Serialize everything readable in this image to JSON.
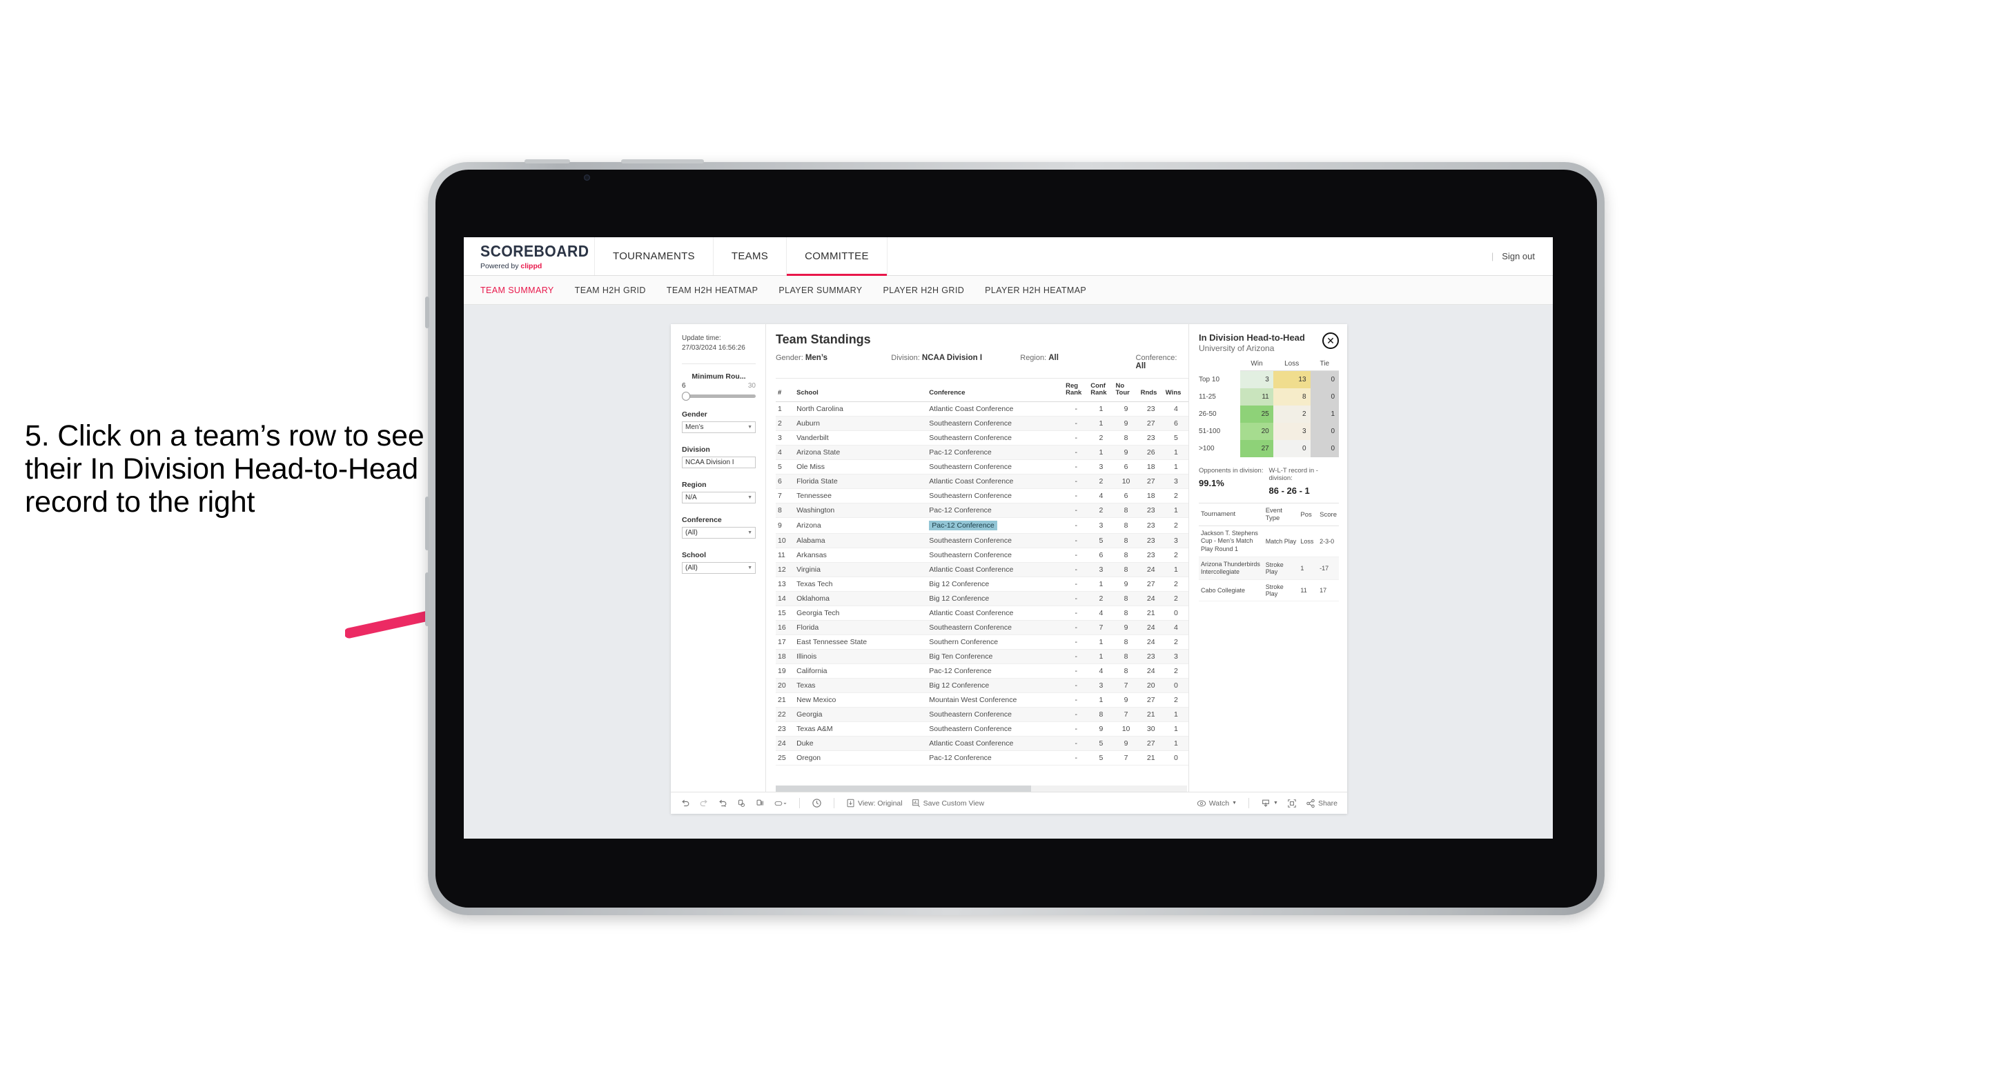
{
  "caption": {
    "text": "5. Click on a team’s row to see their In Division Head-to-Head record to the right"
  },
  "app": {
    "brand_name": "SCOREBOARD",
    "brand_powered_prefix": "Powered by ",
    "brand_powered_name": "clippd",
    "nav_items": [
      {
        "label": "TOURNAMENTS",
        "active": false
      },
      {
        "label": "TEAMS",
        "active": false
      },
      {
        "label": "COMMITTEE",
        "active": true
      }
    ],
    "nav_separator": "|",
    "sign_out_label": "Sign out",
    "subnav_items": [
      {
        "label": "TEAM SUMMARY",
        "active": true
      },
      {
        "label": "TEAM H2H GRID",
        "active": false
      },
      {
        "label": "TEAM H2H HEATMAP",
        "active": false
      },
      {
        "label": "PLAYER SUMMARY",
        "active": false
      },
      {
        "label": "PLAYER H2H GRID",
        "active": false
      },
      {
        "label": "PLAYER H2H HEATMAP",
        "active": false
      }
    ]
  },
  "filters": {
    "update_time_label": "Update time:",
    "update_time_value": "27/03/2024 16:56:26",
    "slider": {
      "title": "Minimum Rou...",
      "min": "6",
      "max": "30"
    },
    "groups": [
      {
        "label": "Gender",
        "value": "Men’s"
      },
      {
        "label": "Division",
        "value": "NCAA Division I"
      },
      {
        "label": "Region",
        "value": "N/A"
      },
      {
        "label": "Conference",
        "value": "(All)"
      },
      {
        "label": "School",
        "value": "(All)"
      }
    ]
  },
  "standings": {
    "title": "Team Standings",
    "context": [
      {
        "label": "Gender:",
        "value": "Men’s"
      },
      {
        "label": "Division:",
        "value": "NCAA Division I"
      },
      {
        "label": "Region:",
        "value": "All"
      },
      {
        "label": "Conference:",
        "value": "All"
      }
    ],
    "columns": [
      "#",
      "School",
      "Conference",
      "Reg Rank",
      "Conf Rank",
      "No Tour",
      "Rnds",
      "Wins"
    ],
    "highlighted_row_index": 8,
    "rows": [
      {
        "rank": "1",
        "school": "North Carolina",
        "conference": "Atlantic Coast Conference",
        "reg_rank": "-",
        "conf_rank": "1",
        "no_tour": "9",
        "rnds": "23",
        "wins": "4"
      },
      {
        "rank": "2",
        "school": "Auburn",
        "conference": "Southeastern Conference",
        "reg_rank": "-",
        "conf_rank": "1",
        "no_tour": "9",
        "rnds": "27",
        "wins": "6"
      },
      {
        "rank": "3",
        "school": "Vanderbilt",
        "conference": "Southeastern Conference",
        "reg_rank": "-",
        "conf_rank": "2",
        "no_tour": "8",
        "rnds": "23",
        "wins": "5"
      },
      {
        "rank": "4",
        "school": "Arizona State",
        "conference": "Pac-12 Conference",
        "reg_rank": "-",
        "conf_rank": "1",
        "no_tour": "9",
        "rnds": "26",
        "wins": "1"
      },
      {
        "rank": "5",
        "school": "Ole Miss",
        "conference": "Southeastern Conference",
        "reg_rank": "-",
        "conf_rank": "3",
        "no_tour": "6",
        "rnds": "18",
        "wins": "1"
      },
      {
        "rank": "6",
        "school": "Florida State",
        "conference": "Atlantic Coast Conference",
        "reg_rank": "-",
        "conf_rank": "2",
        "no_tour": "10",
        "rnds": "27",
        "wins": "3"
      },
      {
        "rank": "7",
        "school": "Tennessee",
        "conference": "Southeastern Conference",
        "reg_rank": "-",
        "conf_rank": "4",
        "no_tour": "6",
        "rnds": "18",
        "wins": "2"
      },
      {
        "rank": "8",
        "school": "Washington",
        "conference": "Pac-12 Conference",
        "reg_rank": "-",
        "conf_rank": "2",
        "no_tour": "8",
        "rnds": "23",
        "wins": "1"
      },
      {
        "rank": "9",
        "school": "Arizona",
        "conference": "Pac-12 Conference",
        "reg_rank": "-",
        "conf_rank": "3",
        "no_tour": "8",
        "rnds": "23",
        "wins": "2"
      },
      {
        "rank": "10",
        "school": "Alabama",
        "conference": "Southeastern Conference",
        "reg_rank": "-",
        "conf_rank": "5",
        "no_tour": "8",
        "rnds": "23",
        "wins": "3"
      },
      {
        "rank": "11",
        "school": "Arkansas",
        "conference": "Southeastern Conference",
        "reg_rank": "-",
        "conf_rank": "6",
        "no_tour": "8",
        "rnds": "23",
        "wins": "2"
      },
      {
        "rank": "12",
        "school": "Virginia",
        "conference": "Atlantic Coast Conference",
        "reg_rank": "-",
        "conf_rank": "3",
        "no_tour": "8",
        "rnds": "24",
        "wins": "1"
      },
      {
        "rank": "13",
        "school": "Texas Tech",
        "conference": "Big 12 Conference",
        "reg_rank": "-",
        "conf_rank": "1",
        "no_tour": "9",
        "rnds": "27",
        "wins": "2"
      },
      {
        "rank": "14",
        "school": "Oklahoma",
        "conference": "Big 12 Conference",
        "reg_rank": "-",
        "conf_rank": "2",
        "no_tour": "8",
        "rnds": "24",
        "wins": "2"
      },
      {
        "rank": "15",
        "school": "Georgia Tech",
        "conference": "Atlantic Coast Conference",
        "reg_rank": "-",
        "conf_rank": "4",
        "no_tour": "8",
        "rnds": "21",
        "wins": "0"
      },
      {
        "rank": "16",
        "school": "Florida",
        "conference": "Southeastern Conference",
        "reg_rank": "-",
        "conf_rank": "7",
        "no_tour": "9",
        "rnds": "24",
        "wins": "4"
      },
      {
        "rank": "17",
        "school": "East Tennessee State",
        "conference": "Southern Conference",
        "reg_rank": "-",
        "conf_rank": "1",
        "no_tour": "8",
        "rnds": "24",
        "wins": "2"
      },
      {
        "rank": "18",
        "school": "Illinois",
        "conference": "Big Ten Conference",
        "reg_rank": "-",
        "conf_rank": "1",
        "no_tour": "8",
        "rnds": "23",
        "wins": "3"
      },
      {
        "rank": "19",
        "school": "California",
        "conference": "Pac-12 Conference",
        "reg_rank": "-",
        "conf_rank": "4",
        "no_tour": "8",
        "rnds": "24",
        "wins": "2"
      },
      {
        "rank": "20",
        "school": "Texas",
        "conference": "Big 12 Conference",
        "reg_rank": "-",
        "conf_rank": "3",
        "no_tour": "7",
        "rnds": "20",
        "wins": "0"
      },
      {
        "rank": "21",
        "school": "New Mexico",
        "conference": "Mountain West Conference",
        "reg_rank": "-",
        "conf_rank": "1",
        "no_tour": "9",
        "rnds": "27",
        "wins": "2"
      },
      {
        "rank": "22",
        "school": "Georgia",
        "conference": "Southeastern Conference",
        "reg_rank": "-",
        "conf_rank": "8",
        "no_tour": "7",
        "rnds": "21",
        "wins": "1"
      },
      {
        "rank": "23",
        "school": "Texas A&M",
        "conference": "Southeastern Conference",
        "reg_rank": "-",
        "conf_rank": "9",
        "no_tour": "10",
        "rnds": "30",
        "wins": "1"
      },
      {
        "rank": "24",
        "school": "Duke",
        "conference": "Atlantic Coast Conference",
        "reg_rank": "-",
        "conf_rank": "5",
        "no_tour": "9",
        "rnds": "27",
        "wins": "1"
      },
      {
        "rank": "25",
        "school": "Oregon",
        "conference": "Pac-12 Conference",
        "reg_rank": "-",
        "conf_rank": "5",
        "no_tour": "7",
        "rnds": "21",
        "wins": "0"
      }
    ]
  },
  "detail": {
    "title": "In Division Head-to-Head",
    "subtitle": "University of Arizona",
    "close_glyph": "✕",
    "h2h_columns": [
      "Win",
      "Loss",
      "Tie"
    ],
    "h2h_rows": [
      {
        "bucket": "Top 10",
        "win": "3",
        "loss": "13",
        "tie": "0",
        "win_color": "#e2efe1",
        "loss_color": "#f0dd8e",
        "tie_color": "#d2d2d2"
      },
      {
        "bucket": "11-25",
        "win": "11",
        "loss": "8",
        "tie": "0",
        "win_color": "#c9e4bd",
        "loss_color": "#f6ecc9",
        "tie_color": "#d2d2d2"
      },
      {
        "bucket": "26-50",
        "win": "25",
        "loss": "2",
        "tie": "1",
        "win_color": "#8ed278",
        "loss_color": "#f2efe6",
        "tie_color": "#d2d2d2"
      },
      {
        "bucket": "51-100",
        "win": "20",
        "loss": "3",
        "tie": "0",
        "win_color": "#a6dc8f",
        "loss_color": "#f4eee2",
        "tie_color": "#d2d2d2"
      },
      {
        "bucket": ">100",
        "win": "27",
        "loss": "0",
        "tie": "0",
        "win_color": "#8ed278",
        "loss_color": "#f2f2f0",
        "tie_color": "#d2d2d2"
      }
    ],
    "stats": [
      {
        "label": "Opponents in division:",
        "value": "99.1%"
      },
      {
        "label": "W-L-T record in -division:",
        "value": "86 - 26 - 1"
      }
    ],
    "tournament_columns": [
      "Tournament",
      "Event Type",
      "Pos",
      "Score"
    ],
    "tournaments": [
      {
        "name": "Jackson T. Stephens Cup - Men’s Match Play Round 1",
        "event_type": "Match Play",
        "pos": "Loss",
        "score": "2-3-0"
      },
      {
        "name": "Arizona Thunderbirds Intercollegiate",
        "event_type": "Stroke Play",
        "pos": "1",
        "score": "-17"
      },
      {
        "name": "Cabo Collegiate",
        "event_type": "Stroke Play",
        "pos": "11",
        "score": "17"
      }
    ]
  },
  "toolbar": {
    "view_label": "View: Original",
    "save_label": "Save Custom View",
    "watch_label": "Watch",
    "share_label": "Share"
  },
  "chart_data": {
    "type": "heatmap",
    "title": "In Division Head-to-Head",
    "subtitle": "University of Arizona",
    "xlabel": "",
    "ylabel": "",
    "categories": [
      "Win",
      "Loss",
      "Tie"
    ],
    "rows": [
      "Top 10",
      "11-25",
      "26-50",
      "51-100",
      ">100"
    ],
    "values": [
      [
        3,
        13,
        0
      ],
      [
        11,
        8,
        0
      ],
      [
        25,
        2,
        1
      ],
      [
        20,
        3,
        0
      ],
      [
        27,
        0,
        0
      ]
    ],
    "totals": {
      "wins": 86,
      "losses": 26,
      "ties": 1,
      "opponents_in_division_pct": 99.1
    },
    "grid": false,
    "legend": "none"
  }
}
